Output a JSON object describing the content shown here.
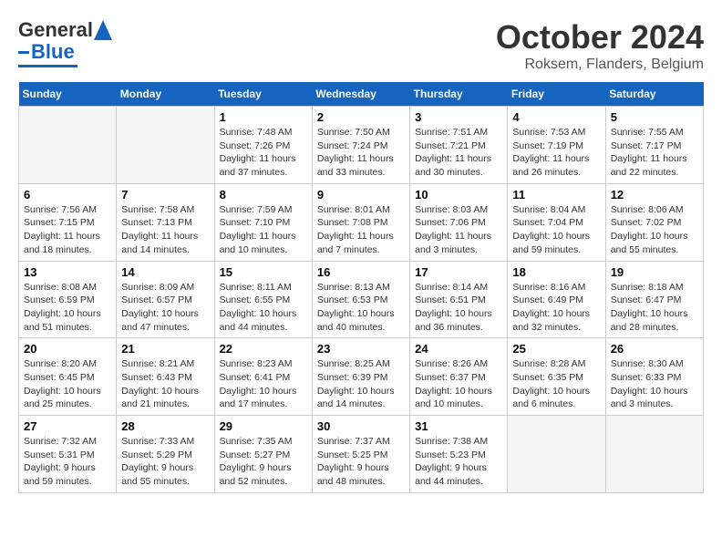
{
  "header": {
    "logo_text_general": "General",
    "logo_text_blue": "Blue",
    "month_title": "October 2024",
    "location": "Roksem, Flanders, Belgium"
  },
  "days_of_week": [
    "Sunday",
    "Monday",
    "Tuesday",
    "Wednesday",
    "Thursday",
    "Friday",
    "Saturday"
  ],
  "weeks": [
    [
      {
        "num": "",
        "info": ""
      },
      {
        "num": "",
        "info": ""
      },
      {
        "num": "1",
        "info": "Sunrise: 7:48 AM\nSunset: 7:26 PM\nDaylight: 11 hours\nand 37 minutes."
      },
      {
        "num": "2",
        "info": "Sunrise: 7:50 AM\nSunset: 7:24 PM\nDaylight: 11 hours\nand 33 minutes."
      },
      {
        "num": "3",
        "info": "Sunrise: 7:51 AM\nSunset: 7:21 PM\nDaylight: 11 hours\nand 30 minutes."
      },
      {
        "num": "4",
        "info": "Sunrise: 7:53 AM\nSunset: 7:19 PM\nDaylight: 11 hours\nand 26 minutes."
      },
      {
        "num": "5",
        "info": "Sunrise: 7:55 AM\nSunset: 7:17 PM\nDaylight: 11 hours\nand 22 minutes."
      }
    ],
    [
      {
        "num": "6",
        "info": "Sunrise: 7:56 AM\nSunset: 7:15 PM\nDaylight: 11 hours\nand 18 minutes."
      },
      {
        "num": "7",
        "info": "Sunrise: 7:58 AM\nSunset: 7:13 PM\nDaylight: 11 hours\nand 14 minutes."
      },
      {
        "num": "8",
        "info": "Sunrise: 7:59 AM\nSunset: 7:10 PM\nDaylight: 11 hours\nand 10 minutes."
      },
      {
        "num": "9",
        "info": "Sunrise: 8:01 AM\nSunset: 7:08 PM\nDaylight: 11 hours\nand 7 minutes."
      },
      {
        "num": "10",
        "info": "Sunrise: 8:03 AM\nSunset: 7:06 PM\nDaylight: 11 hours\nand 3 minutes."
      },
      {
        "num": "11",
        "info": "Sunrise: 8:04 AM\nSunset: 7:04 PM\nDaylight: 10 hours\nand 59 minutes."
      },
      {
        "num": "12",
        "info": "Sunrise: 8:06 AM\nSunset: 7:02 PM\nDaylight: 10 hours\nand 55 minutes."
      }
    ],
    [
      {
        "num": "13",
        "info": "Sunrise: 8:08 AM\nSunset: 6:59 PM\nDaylight: 10 hours\nand 51 minutes."
      },
      {
        "num": "14",
        "info": "Sunrise: 8:09 AM\nSunset: 6:57 PM\nDaylight: 10 hours\nand 47 minutes."
      },
      {
        "num": "15",
        "info": "Sunrise: 8:11 AM\nSunset: 6:55 PM\nDaylight: 10 hours\nand 44 minutes."
      },
      {
        "num": "16",
        "info": "Sunrise: 8:13 AM\nSunset: 6:53 PM\nDaylight: 10 hours\nand 40 minutes."
      },
      {
        "num": "17",
        "info": "Sunrise: 8:14 AM\nSunset: 6:51 PM\nDaylight: 10 hours\nand 36 minutes."
      },
      {
        "num": "18",
        "info": "Sunrise: 8:16 AM\nSunset: 6:49 PM\nDaylight: 10 hours\nand 32 minutes."
      },
      {
        "num": "19",
        "info": "Sunrise: 8:18 AM\nSunset: 6:47 PM\nDaylight: 10 hours\nand 28 minutes."
      }
    ],
    [
      {
        "num": "20",
        "info": "Sunrise: 8:20 AM\nSunset: 6:45 PM\nDaylight: 10 hours\nand 25 minutes."
      },
      {
        "num": "21",
        "info": "Sunrise: 8:21 AM\nSunset: 6:43 PM\nDaylight: 10 hours\nand 21 minutes."
      },
      {
        "num": "22",
        "info": "Sunrise: 8:23 AM\nSunset: 6:41 PM\nDaylight: 10 hours\nand 17 minutes."
      },
      {
        "num": "23",
        "info": "Sunrise: 8:25 AM\nSunset: 6:39 PM\nDaylight: 10 hours\nand 14 minutes."
      },
      {
        "num": "24",
        "info": "Sunrise: 8:26 AM\nSunset: 6:37 PM\nDaylight: 10 hours\nand 10 minutes."
      },
      {
        "num": "25",
        "info": "Sunrise: 8:28 AM\nSunset: 6:35 PM\nDaylight: 10 hours\nand 6 minutes."
      },
      {
        "num": "26",
        "info": "Sunrise: 8:30 AM\nSunset: 6:33 PM\nDaylight: 10 hours\nand 3 minutes."
      }
    ],
    [
      {
        "num": "27",
        "info": "Sunrise: 7:32 AM\nSunset: 5:31 PM\nDaylight: 9 hours\nand 59 minutes."
      },
      {
        "num": "28",
        "info": "Sunrise: 7:33 AM\nSunset: 5:29 PM\nDaylight: 9 hours\nand 55 minutes."
      },
      {
        "num": "29",
        "info": "Sunrise: 7:35 AM\nSunset: 5:27 PM\nDaylight: 9 hours\nand 52 minutes."
      },
      {
        "num": "30",
        "info": "Sunrise: 7:37 AM\nSunset: 5:25 PM\nDaylight: 9 hours\nand 48 minutes."
      },
      {
        "num": "31",
        "info": "Sunrise: 7:38 AM\nSunset: 5:23 PM\nDaylight: 9 hours\nand 44 minutes."
      },
      {
        "num": "",
        "info": ""
      },
      {
        "num": "",
        "info": ""
      }
    ]
  ]
}
